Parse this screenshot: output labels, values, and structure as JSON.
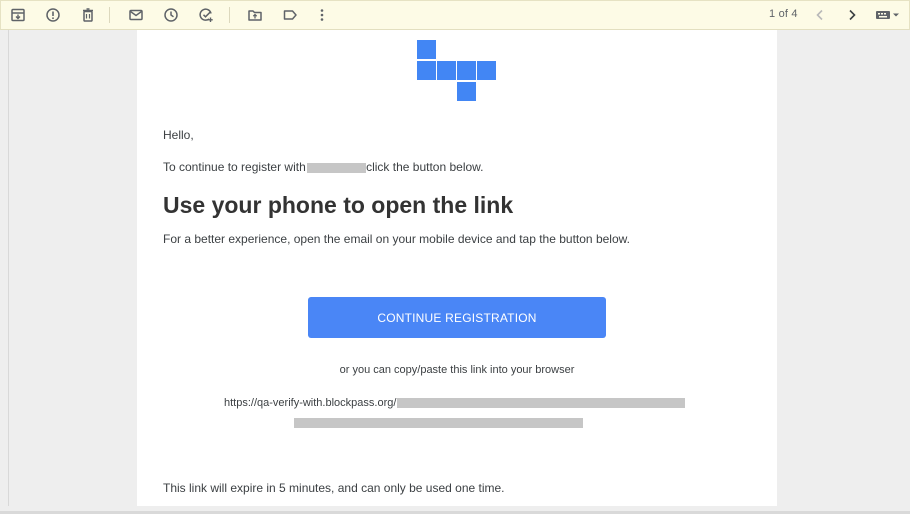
{
  "toolbar": {
    "buttons": [
      {
        "name": "archive",
        "icon": "archive-icon"
      },
      {
        "name": "report-spam",
        "icon": "report-icon"
      },
      {
        "name": "delete",
        "icon": "trash-icon"
      },
      {
        "name": "mark-unread",
        "icon": "mail-icon"
      },
      {
        "name": "snooze",
        "icon": "clock-icon"
      },
      {
        "name": "add-to-tasks",
        "icon": "task-add-icon"
      },
      {
        "name": "move-to",
        "icon": "folder-move-icon"
      },
      {
        "name": "labels",
        "icon": "label-icon"
      },
      {
        "name": "more",
        "icon": "more-vert-icon"
      }
    ],
    "pager_text": "1 of 4",
    "colors": {
      "background": "#fdfbe6",
      "icon": "#5f6368"
    }
  },
  "email": {
    "greeting": "Hello,",
    "intro_prefix": "To continue to register with",
    "intro_suffix": "click the button below.",
    "headline": "Use your phone to open the link",
    "subline": "For a better experience, open the email on your mobile device and tap the button below.",
    "button_label": "CONTINUE REGISTRATION",
    "copy_note": "or you can copy/paste this link into your browser",
    "link_prefix": "https://qa-verify-with.blockpass.org/",
    "expire_note": "This link will expire in 5 minutes, and can only be used one time.",
    "colors": {
      "accent": "#4a86f6",
      "logo": "#4286f4",
      "redaction": "#c6c6c6"
    }
  }
}
